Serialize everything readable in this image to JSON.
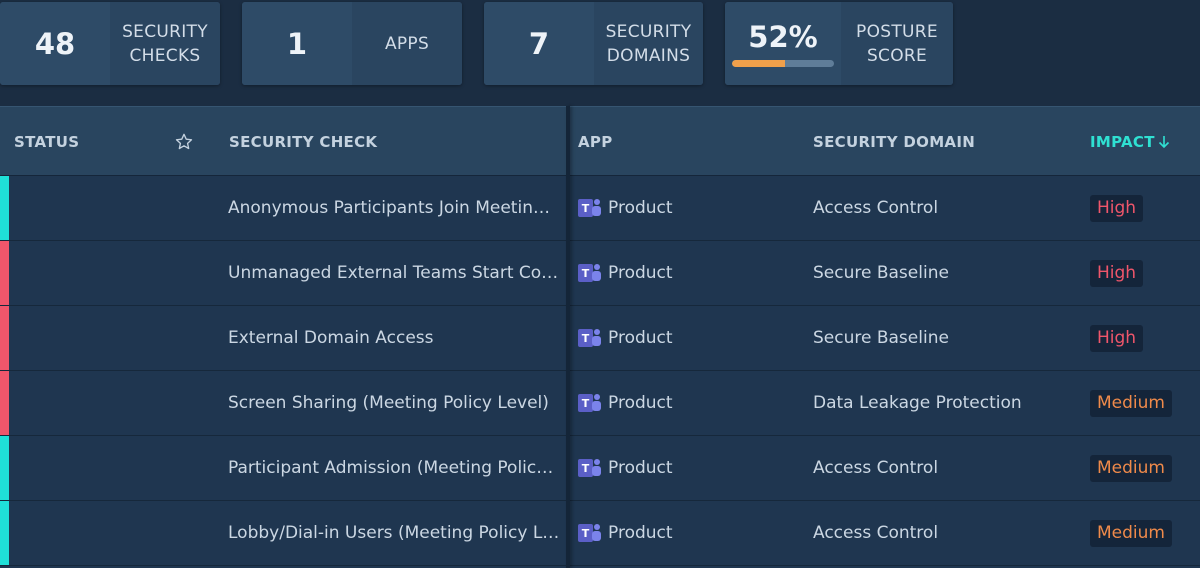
{
  "stats": [
    {
      "value": "48",
      "label": "SECURITY CHECKS"
    },
    {
      "value": "1",
      "label": "APPS"
    },
    {
      "value": "7",
      "label": "SECURITY DOMAINS"
    },
    {
      "value": "52%",
      "label": "POSTURE SCORE",
      "progress": 0.52
    }
  ],
  "colors": {
    "accent": "#2fe0d2",
    "status_pass": "#1fe0d8",
    "status_fail": "#f0566b",
    "impact_high": "#f0566b",
    "impact_medium": "#ef8a4a",
    "score_bar": "#f0a04b"
  },
  "table": {
    "headers": {
      "status": "STATUS",
      "favorite_icon": "star-icon",
      "check": "SECURITY CHECK",
      "app": "APP",
      "domain": "SECURITY DOMAIN",
      "impact": "IMPACT",
      "sort_icon": "arrow-down-icon"
    },
    "rows": [
      {
        "status": "pass",
        "check": "Anonymous Participants Join Meetin…",
        "app_icon": "teams-icon",
        "app": "Product",
        "domain": "Access Control",
        "impact": "High"
      },
      {
        "status": "fail",
        "check": "Unmanaged External Teams Start Co…",
        "app_icon": "teams-icon",
        "app": "Product",
        "domain": "Secure Baseline",
        "impact": "High"
      },
      {
        "status": "fail",
        "check": "External Domain Access",
        "app_icon": "teams-icon",
        "app": "Product",
        "domain": "Secure Baseline",
        "impact": "High"
      },
      {
        "status": "fail",
        "check": "Screen Sharing (Meeting Policy Level)",
        "app_icon": "teams-icon",
        "app": "Product",
        "domain": "Data Leakage Protection",
        "impact": "Medium"
      },
      {
        "status": "pass",
        "check": "Participant Admission (Meeting Polic…",
        "app_icon": "teams-icon",
        "app": "Product",
        "domain": "Access Control",
        "impact": "Medium"
      },
      {
        "status": "pass",
        "check": "Lobby/Dial-in Users (Meeting Policy L…",
        "app_icon": "teams-icon",
        "app": "Product",
        "domain": "Access Control",
        "impact": "Medium"
      }
    ]
  }
}
